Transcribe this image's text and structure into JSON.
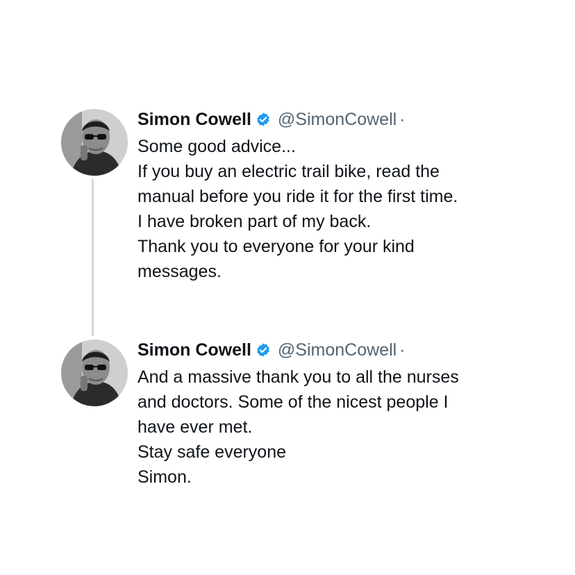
{
  "tweets": [
    {
      "name": "Simon Cowell",
      "handle": "@SimonCowell",
      "separator": "·",
      "avatar_icon": "profile-photo",
      "verified_icon": "verified-badge-icon",
      "lines": [
        "Some good advice...",
        "If you buy an electric trail bike, read the",
        "manual before you ride it for the first time.",
        "I have broken part of my back.",
        "Thank you to everyone for your kind",
        "messages."
      ]
    },
    {
      "name": "Simon Cowell",
      "handle": "@SimonCowell",
      "separator": "·",
      "avatar_icon": "profile-photo",
      "verified_icon": "verified-badge-icon",
      "lines": [
        "And a massive thank you to all the nurses",
        "and doctors. Some of the nicest people I",
        "have ever met.",
        "Stay safe everyone",
        "Simon."
      ]
    }
  ],
  "colors": {
    "name": "#0f1419",
    "handle": "#536471",
    "verified": "#1d9bf0",
    "thread_line": "#cfd9de"
  }
}
